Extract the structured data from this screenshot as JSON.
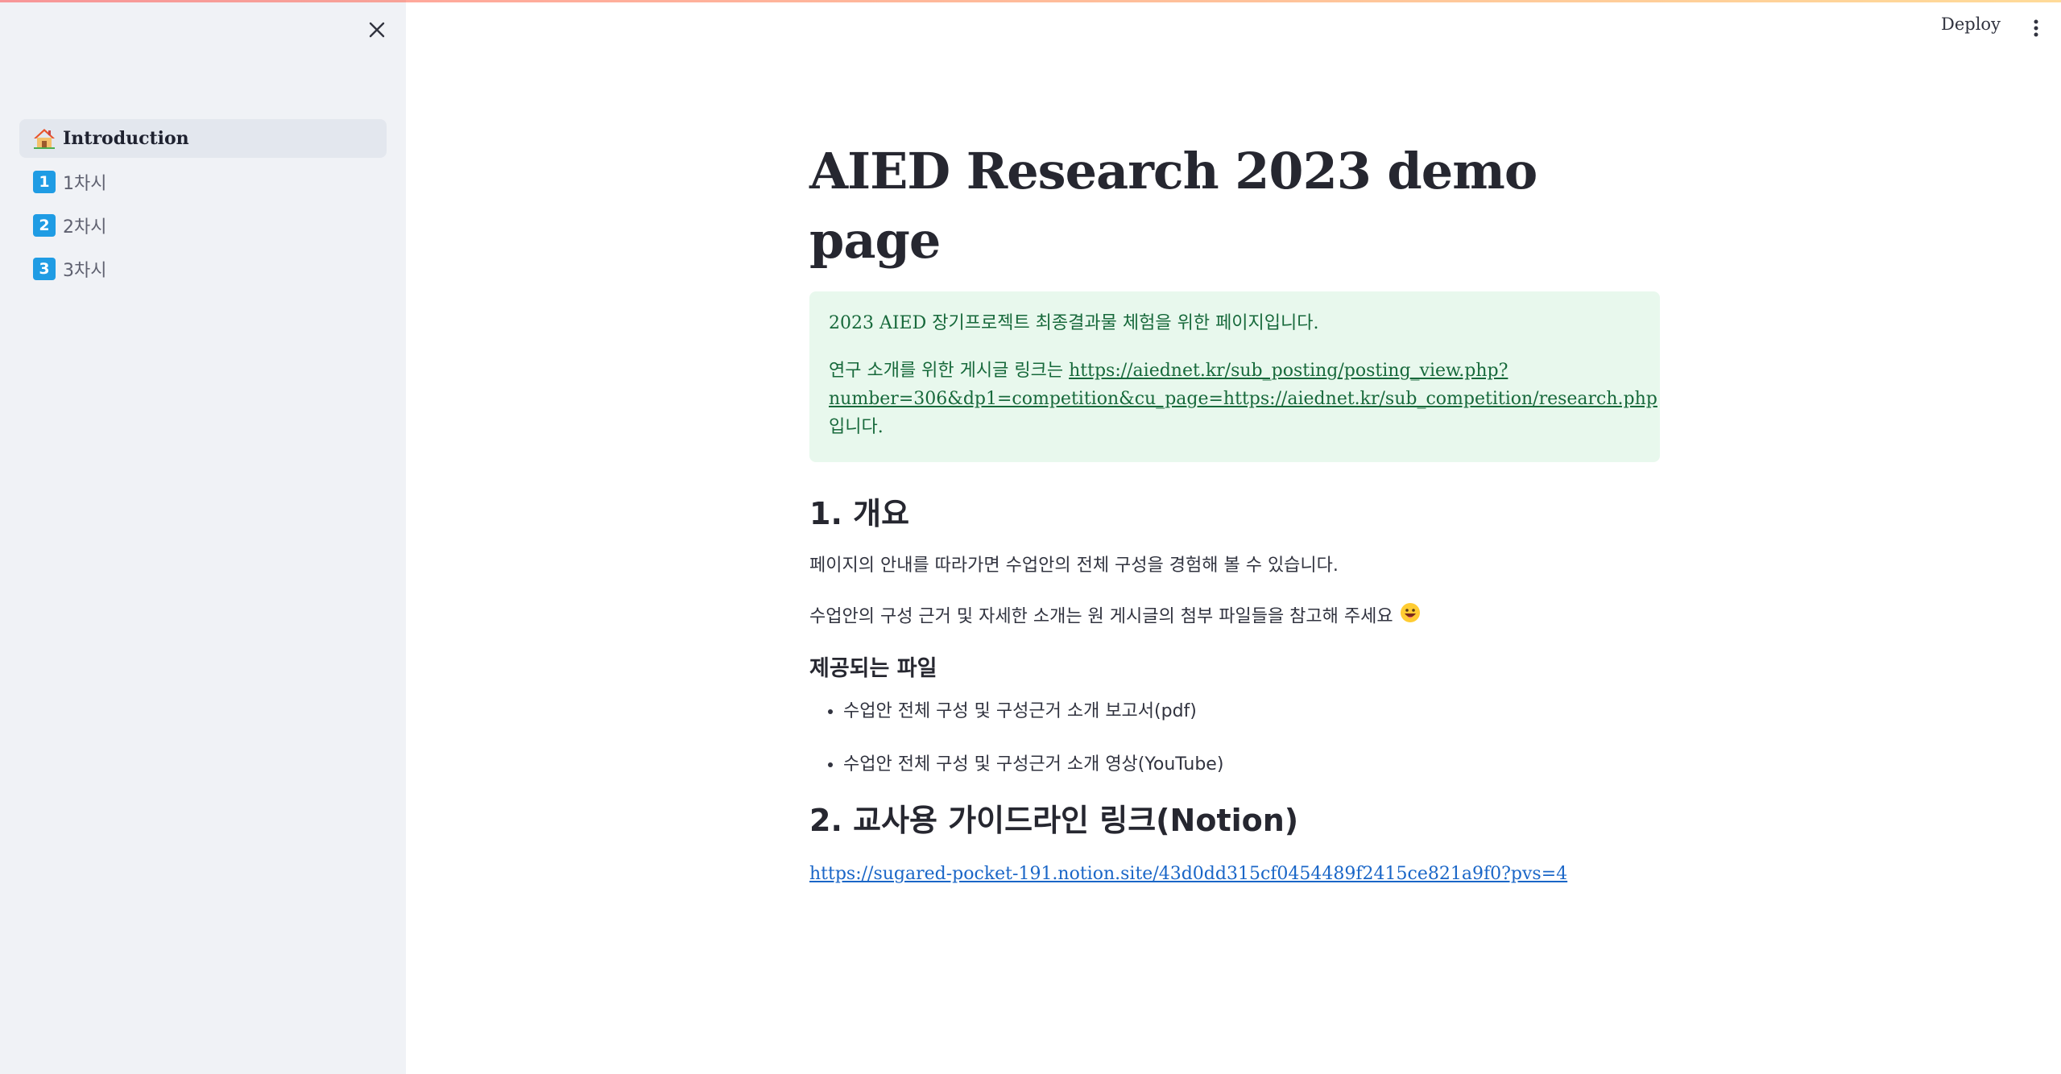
{
  "header": {
    "deploy_label": "Deploy",
    "menu_icon": "kebab-menu-icon"
  },
  "sidebar": {
    "close_icon": "close-icon",
    "items": [
      {
        "icon": "house-icon",
        "label": "Introduction",
        "active": true
      },
      {
        "icon": "keycap-1-icon",
        "badge": "1",
        "label": "1차시",
        "active": false
      },
      {
        "icon": "keycap-2-icon",
        "badge": "2",
        "label": "2차시",
        "active": false
      },
      {
        "icon": "keycap-3-icon",
        "badge": "3",
        "label": "3차시",
        "active": false
      }
    ]
  },
  "main": {
    "title": "AIED Research 2023 demo page",
    "callout": {
      "line1": "2023 AIED 장기프로젝트 최종결과물 체험을 위한 페이지입니다.",
      "line2_prefix": "연구 소개를 위한 게시글 링크는 ",
      "line2_link": "https://aiednet.kr/sub_posting/posting_view.php?number=306&dp1=competition&cu_page=https://aiednet.kr/sub_competition/research.php",
      "line2_suffix": " 입니다."
    },
    "section1": {
      "heading": "1. 개요",
      "para1": "페이지의 안내를 따라가면 수업안의 전체 구성을 경험해 볼 수 있습니다.",
      "para2": "수업안의 구성 근거 및 자세한 소개는 원 게시글의 첨부 파일들을 참고해 주세요",
      "para2_emoji": "grinning-face-icon",
      "subheading": "제공되는 파일",
      "files": [
        "수업안 전체 구성 및 구성근거 소개 보고서(pdf)",
        "수업안 전체 구성 및 구성근거 소개 영상(YouTube)"
      ]
    },
    "section2": {
      "heading": "2. 교사용 가이드라인 링크(Notion)",
      "link": "https://sugared-pocket-191.notion.site/43d0dd315cf0454489f2415ce821a9f0?pvs=4"
    }
  },
  "colors": {
    "sidebar_bg": "#f0f2f6",
    "active_item_bg": "#e3e7ee",
    "callout_bg": "#e8f8ed",
    "callout_text": "#17693b",
    "link": "#1a66c7",
    "badge": "#1f9ce4"
  }
}
